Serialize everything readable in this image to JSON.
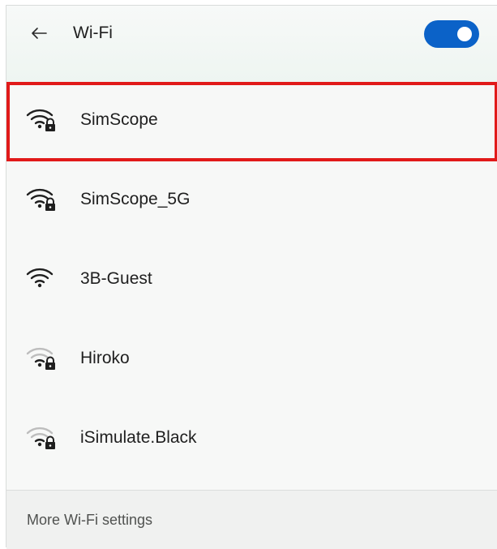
{
  "header": {
    "title": "Wi-Fi",
    "toggle_on": true,
    "accent_color": "#0b62c8"
  },
  "networks": [
    {
      "name": "SimScope",
      "secured": true,
      "signal": "full",
      "selected": true
    },
    {
      "name": "SimScope_5G",
      "secured": true,
      "signal": "full",
      "selected": false
    },
    {
      "name": "3B-Guest",
      "secured": false,
      "signal": "full",
      "selected": false
    },
    {
      "name": "Hiroko",
      "secured": true,
      "signal": "weak",
      "selected": false
    },
    {
      "name": "iSimulate.Black",
      "secured": true,
      "signal": "weak",
      "selected": false
    }
  ],
  "footer": {
    "link_label": "More Wi-Fi settings"
  },
  "icons": {
    "back": "back-arrow-icon",
    "wifi": "wifi-icon",
    "lock": "lock-icon"
  },
  "highlight_color": "#e11a1a"
}
